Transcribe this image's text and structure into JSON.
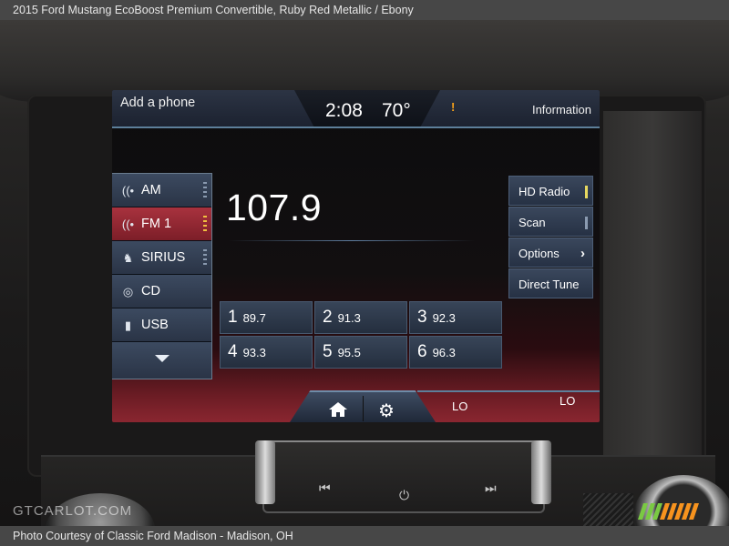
{
  "caption": {
    "top": "2015 Ford Mustang EcoBoost Premium Convertible,   Ruby Red Metallic / Ebony",
    "bottom": "Photo Courtesy of Classic Ford Madison - Madison, OH"
  },
  "watermark": {
    "text": "GTCARLOT.COM",
    "stripe_colors": [
      "#7ac943",
      "#f7931e"
    ]
  },
  "header": {
    "add_phone": "Add a phone",
    "clock": "2:08",
    "temperature": "70°",
    "alert": "!",
    "information": "Information"
  },
  "sources": [
    {
      "label": "AM",
      "icon": "radio-icon",
      "active": false
    },
    {
      "label": "FM 1",
      "icon": "radio-icon",
      "active": true
    },
    {
      "label": "SIRIUS",
      "icon": "sirius-icon",
      "active": false
    },
    {
      "label": "CD",
      "icon": "disc-icon",
      "active": false
    },
    {
      "label": "USB",
      "icon": "usb-icon",
      "active": false
    }
  ],
  "frequency": "107.9",
  "options": {
    "hd_radio": "HD Radio",
    "scan": "Scan",
    "options": "Options",
    "direct_tune": "Direct Tune"
  },
  "presets": [
    {
      "num": "1",
      "freq": "89.7"
    },
    {
      "num": "2",
      "freq": "91.3"
    },
    {
      "num": "3",
      "freq": "92.3"
    },
    {
      "num": "4",
      "freq": "93.3"
    },
    {
      "num": "5",
      "freq": "95.5"
    },
    {
      "num": "6",
      "freq": "96.3"
    }
  ],
  "climate": {
    "left": "LO",
    "right": "LO"
  },
  "colors": {
    "active_source": "#a8323e",
    "header_line": "#5d7f9a",
    "alert": "#f7a11a"
  }
}
